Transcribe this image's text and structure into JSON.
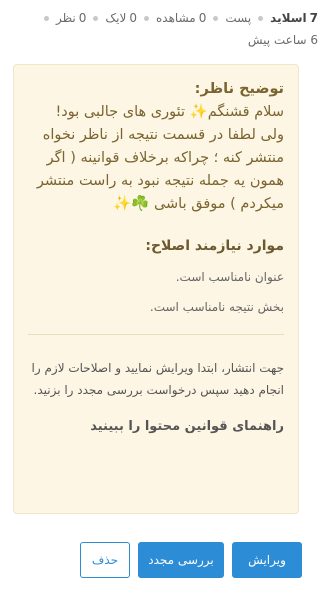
{
  "stats": {
    "slides": {
      "count": "7",
      "label": "اسلاید"
    },
    "post": {
      "label": "پست"
    },
    "views": {
      "count": "0",
      "label": "مشاهده"
    },
    "likes": {
      "count": "0",
      "label": "لایک"
    },
    "comments": {
      "count": "0",
      "label": "نظر"
    },
    "time": "6 ساعت پیش"
  },
  "card": {
    "reviewer_title": "توضیح ناظر:",
    "reviewer_text": "سلام قشنگم✨ تئوری های جالبی بود! ولی لطفا در قسمت نتیجه از ناظر نخواه منتشر کنه ؛ چراکه برخلاف قوانینه ( اگر همون یه جمله نتیجه نبود به راست منتشر میکردم ) موفق باشی ☘️✨",
    "fixes_title": "موارد نیازمند اصلاح:",
    "fixes": [
      "عنوان نامناسب است.",
      "بخش نتیجه نامناسب است."
    ],
    "instructions": "جهت انتشار، ابتدا ویرایش نمایید و اصلاحات لازم را انجام دهید سپس درخواست بررسی مجدد را بزنید.",
    "guide_link": "راهنمای قوانین محتوا را ببینید"
  },
  "buttons": {
    "edit": "ویرایش",
    "review": "بررسی مجدد",
    "delete": "حذف"
  },
  "colors": {
    "accent": "#2d8cd6",
    "card_bg": "#fdf6e4",
    "note_text": "#7a6530"
  }
}
